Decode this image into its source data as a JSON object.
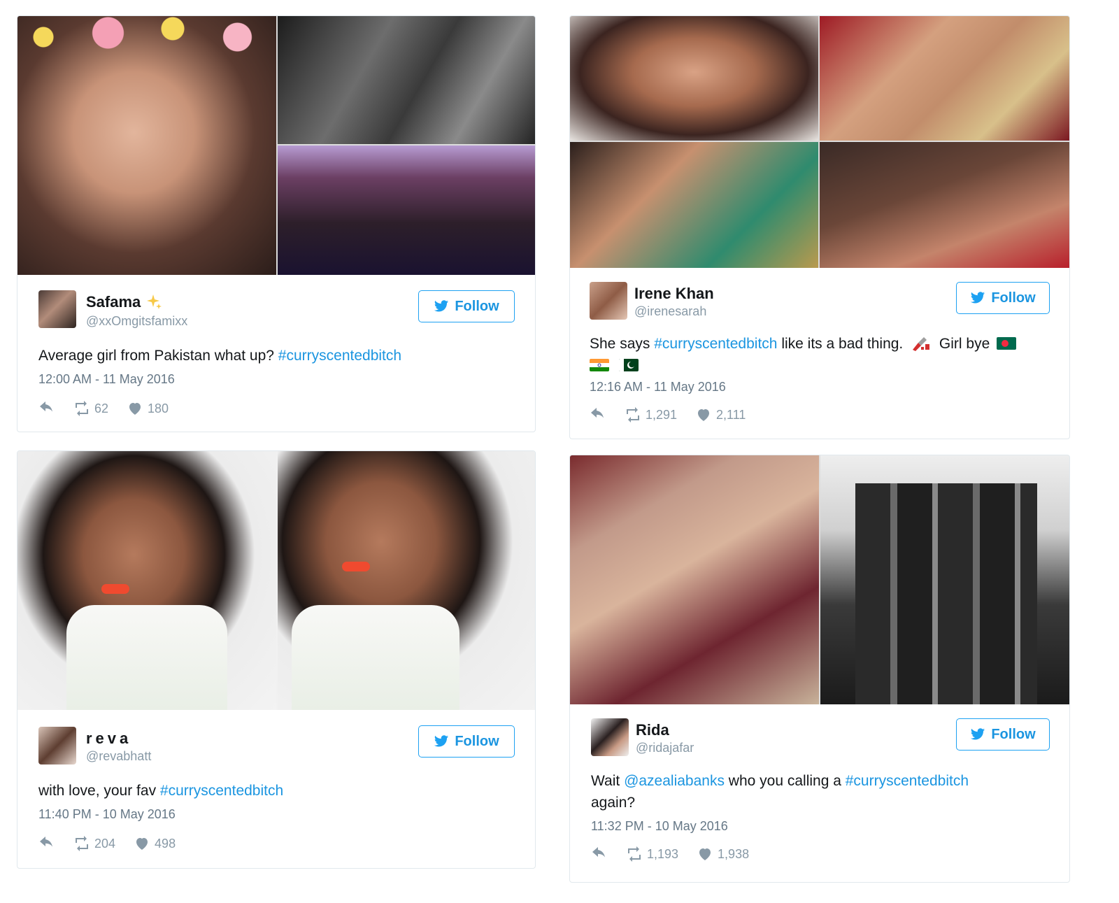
{
  "tweets": [
    {
      "name": "Safama",
      "handle": "@xxOmgitsfamixx",
      "follow_label": "Follow",
      "text_before": "Average girl from Pakistan what up? ",
      "hashtag": "#curryscentedbitch",
      "time": "12:00 AM - 11 May 2016",
      "retweets": "62",
      "likes": "180"
    },
    {
      "name": "Irene Khan",
      "handle": "@irenesarah",
      "follow_label": "Follow",
      "text_before": "She says ",
      "hashtag": "#curryscentedbitch",
      "text_after": " like its a bad thing. ",
      "text_after2": " Girl bye",
      "time": "12:16 AM - 11 May 2016",
      "retweets": "1,291",
      "likes": "2,111"
    },
    {
      "name": "reva",
      "handle": "@revabhatt",
      "follow_label": "Follow",
      "text_before": "with love, your fav ",
      "hashtag": "#curryscentedbitch",
      "time": "11:40 PM - 10 May 2016",
      "retweets": "204",
      "likes": "498"
    },
    {
      "name": "Rida",
      "handle": "@ridajafar",
      "follow_label": "Follow",
      "text_before": "Wait ",
      "mention": "@azealiabanks",
      "text_middle": " who you calling a ",
      "hashtag": "#curryscentedbitch",
      "text_after": "again?",
      "time": "11:32 PM - 10 May 2016",
      "retweets": "1,193",
      "likes": "1,938"
    }
  ],
  "colors": {
    "twitter_blue": "#1da1f2",
    "link": "#1b95e0",
    "meta_gray": "#8899a6",
    "border": "#e1e8ed"
  },
  "icons": [
    "twitter-bird-icon",
    "reply-icon",
    "retweet-icon",
    "heart-icon",
    "sparkles-icon",
    "nail-polish-icon",
    "flag-bangladesh-icon",
    "flag-india-icon",
    "flag-pakistan-icon"
  ]
}
